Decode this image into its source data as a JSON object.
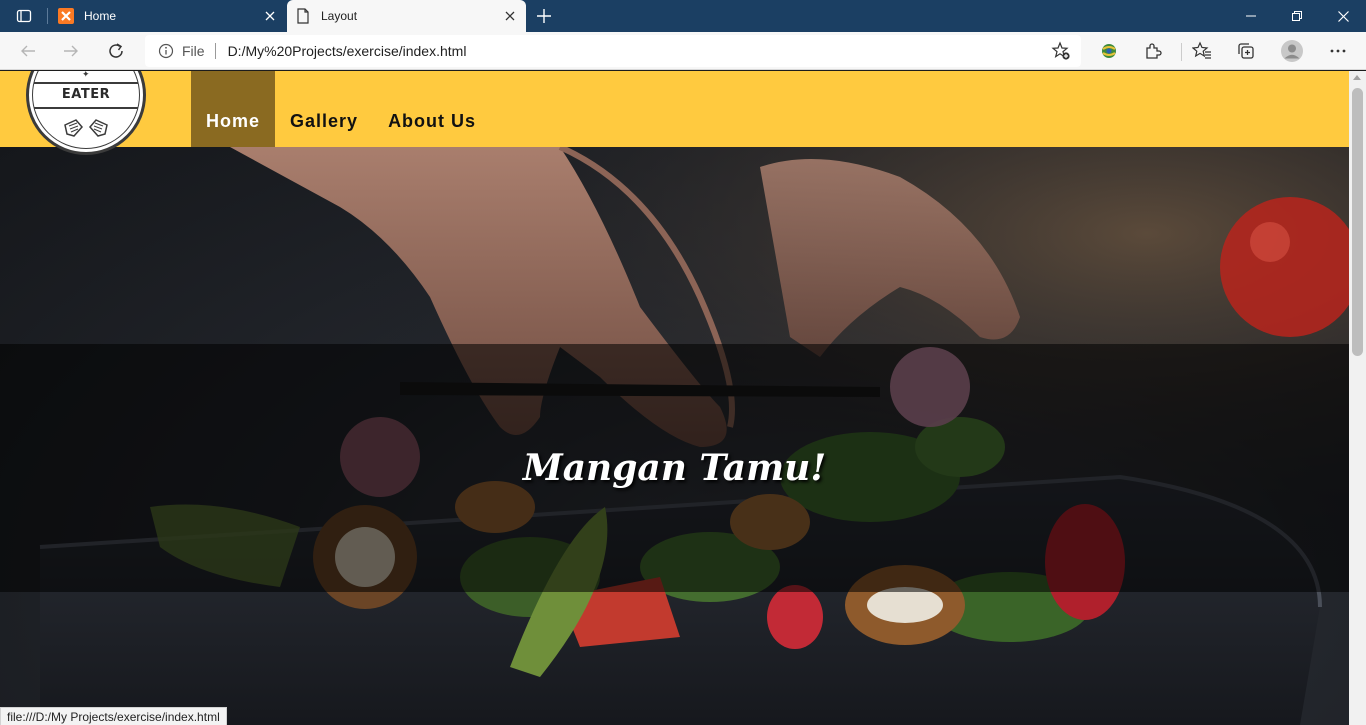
{
  "browser": {
    "tabs": [
      {
        "title": "Home",
        "favicon": "xampp-icon",
        "active": false
      },
      {
        "title": "Layout",
        "favicon": "document-icon",
        "active": true
      }
    ],
    "address": {
      "scheme_label": "File",
      "url": "D:/My%20Projects/exercise/index.html"
    },
    "status_url": "file:///D:/My Projects/exercise/index.html",
    "colors": {
      "titlebar": "#1b3f63",
      "toolbar": "#f7f7f7"
    }
  },
  "site": {
    "logo": {
      "text": "EATER"
    },
    "nav": [
      {
        "label": "Home",
        "active": true
      },
      {
        "label": "Gallery",
        "active": false
      },
      {
        "label": "About Us",
        "active": false
      }
    ],
    "hero": {
      "title": "Mangan Tamu!"
    },
    "colors": {
      "header": "#ffca3f",
      "active_nav": "#8a6a21",
      "hero_overlay": "rgba(0,0,0,0.55)"
    }
  }
}
